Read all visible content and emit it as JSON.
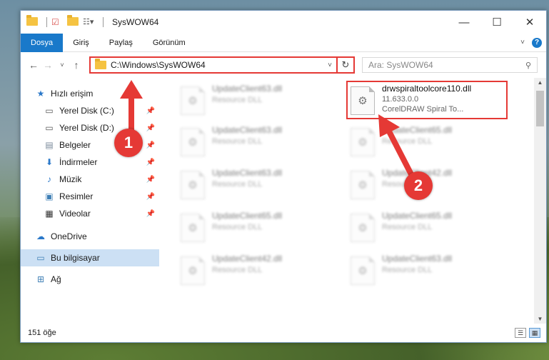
{
  "window": {
    "title": "SysWOW64",
    "controls": [
      "—",
      "☐",
      "✕"
    ]
  },
  "ribbon": {
    "tabs": [
      "Dosya",
      "Giriş",
      "Paylaş",
      "Görünüm"
    ],
    "help": "?"
  },
  "address": {
    "path": "C:\\Windows\\SysWOW64",
    "search_placeholder": "Ara: SysWOW64"
  },
  "sidebar": {
    "items": [
      {
        "label": "Hızlı erişim",
        "icon": "star-icon"
      },
      {
        "label": "Yerel Disk (C:)",
        "icon": "drive-icon"
      },
      {
        "label": "Yerel Disk (D:)",
        "icon": "drive-icon"
      },
      {
        "label": "Belgeler",
        "icon": "documents-icon"
      },
      {
        "label": "İndirmeler",
        "icon": "download-icon"
      },
      {
        "label": "Müzik",
        "icon": "music-icon"
      },
      {
        "label": "Resimler",
        "icon": "pictures-icon"
      },
      {
        "label": "Videolar",
        "icon": "video-icon"
      },
      {
        "label": "OneDrive",
        "icon": "cloud-icon"
      },
      {
        "label": "Bu bilgisayar",
        "icon": "computer-icon"
      },
      {
        "label": "Ağ",
        "icon": "network-icon"
      }
    ]
  },
  "files": [
    {
      "name": "UpdateClient63.dll",
      "type": "Resource DLL"
    },
    {
      "name": "drwspiraltoolcore110.dll",
      "version": "11.633.0.0",
      "type": "CorelDRAW Spiral To..."
    },
    {
      "name": "UpdateClient63.dll",
      "type": "Resource DLL"
    },
    {
      "name": "UpdateClient65.dll",
      "type": "Resource DLL"
    },
    {
      "name": "UpdateClient63.dll",
      "type": "Resource DLL"
    },
    {
      "name": "UpdateClient42.dll",
      "type": "Resource DLL"
    },
    {
      "name": "UpdateClient65.dll",
      "type": "Resource DLL"
    },
    {
      "name": "UpdateClient65.dll",
      "type": "Resource DLL"
    },
    {
      "name": "UpdateClient42.dll",
      "type": "Resource DLL"
    },
    {
      "name": "UpdateClient63.dll",
      "type": "Resource DLL"
    }
  ],
  "status": {
    "count": "151 öğe"
  },
  "annotations": {
    "step1": "1",
    "step2": "2",
    "color": "#e53935"
  }
}
